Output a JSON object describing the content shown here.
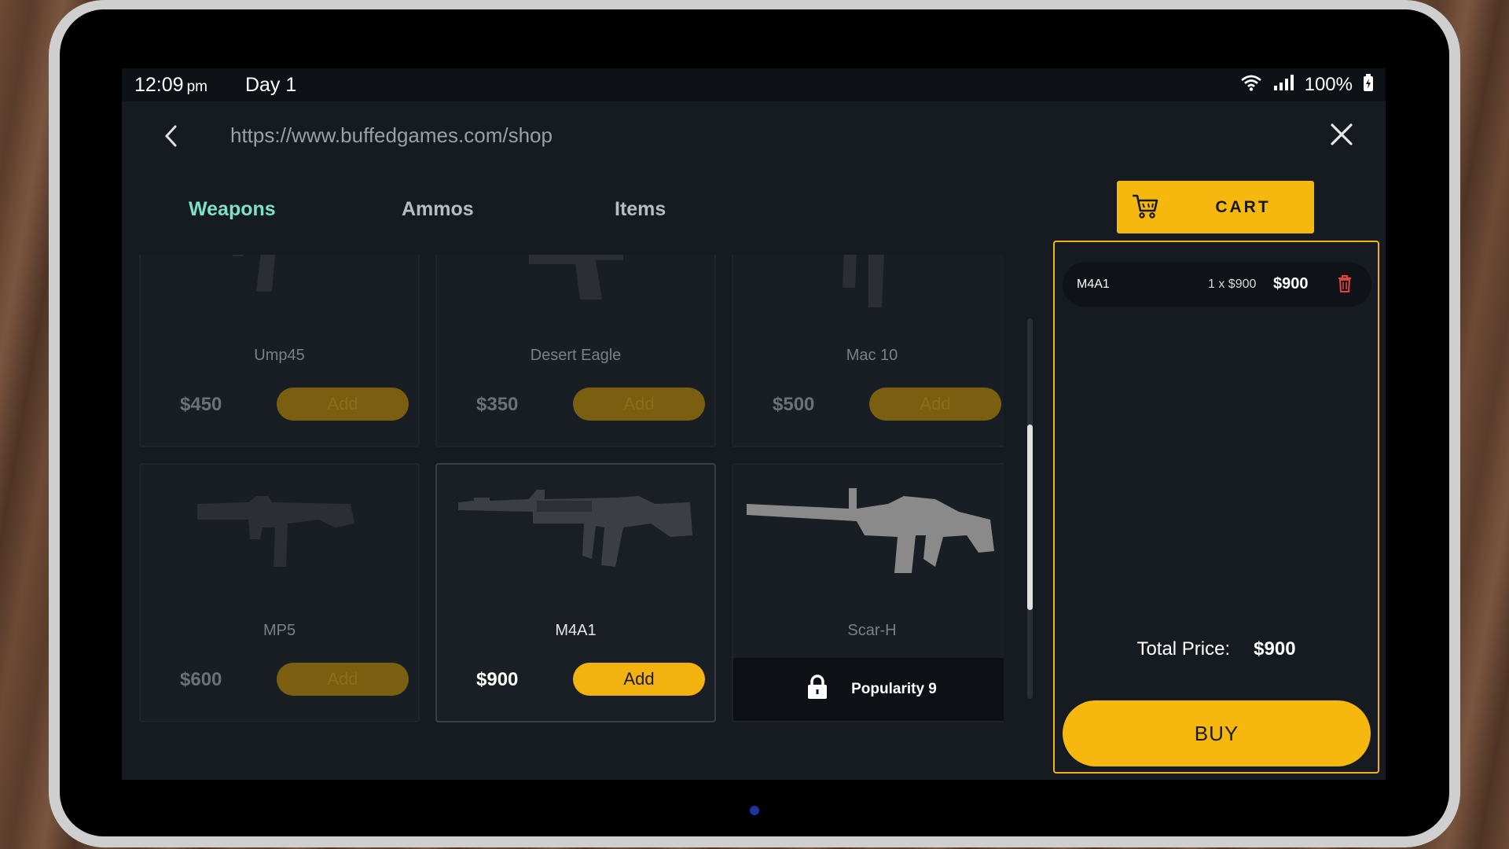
{
  "status": {
    "time": "12:09",
    "ampm": "pm",
    "day": "Day 1",
    "battery": "100%"
  },
  "browser": {
    "url": "https://www.buffedgames.com/shop"
  },
  "tabs": [
    {
      "label": "Weapons",
      "active": true
    },
    {
      "label": "Ammos",
      "active": false
    },
    {
      "label": "Items",
      "active": false
    }
  ],
  "weapons": [
    {
      "name": "Ump45",
      "price": "$450",
      "button": "Add",
      "state": "disabled"
    },
    {
      "name": "Desert Eagle",
      "price": "$350",
      "button": "Add",
      "state": "disabled"
    },
    {
      "name": "Mac 10",
      "price": "$500",
      "button": "Add",
      "state": "disabled"
    },
    {
      "name": "MP5",
      "price": "$600",
      "button": "Add",
      "state": "disabled"
    },
    {
      "name": "M4A1",
      "price": "$900",
      "button": "Add",
      "state": "active"
    },
    {
      "name": "Scar-H",
      "lock_text": "Popularity 9",
      "state": "locked"
    }
  ],
  "cart": {
    "button_label": "CART",
    "items": [
      {
        "name": "M4A1",
        "qty": "1 x $900",
        "subtotal": "$900"
      }
    ],
    "total_label": "Total Price:",
    "total_value": "$900",
    "buy_label": "BUY"
  },
  "colors": {
    "accent": "#f6b80e",
    "active_tab": "#7fe0c8",
    "background": "#161a21"
  }
}
